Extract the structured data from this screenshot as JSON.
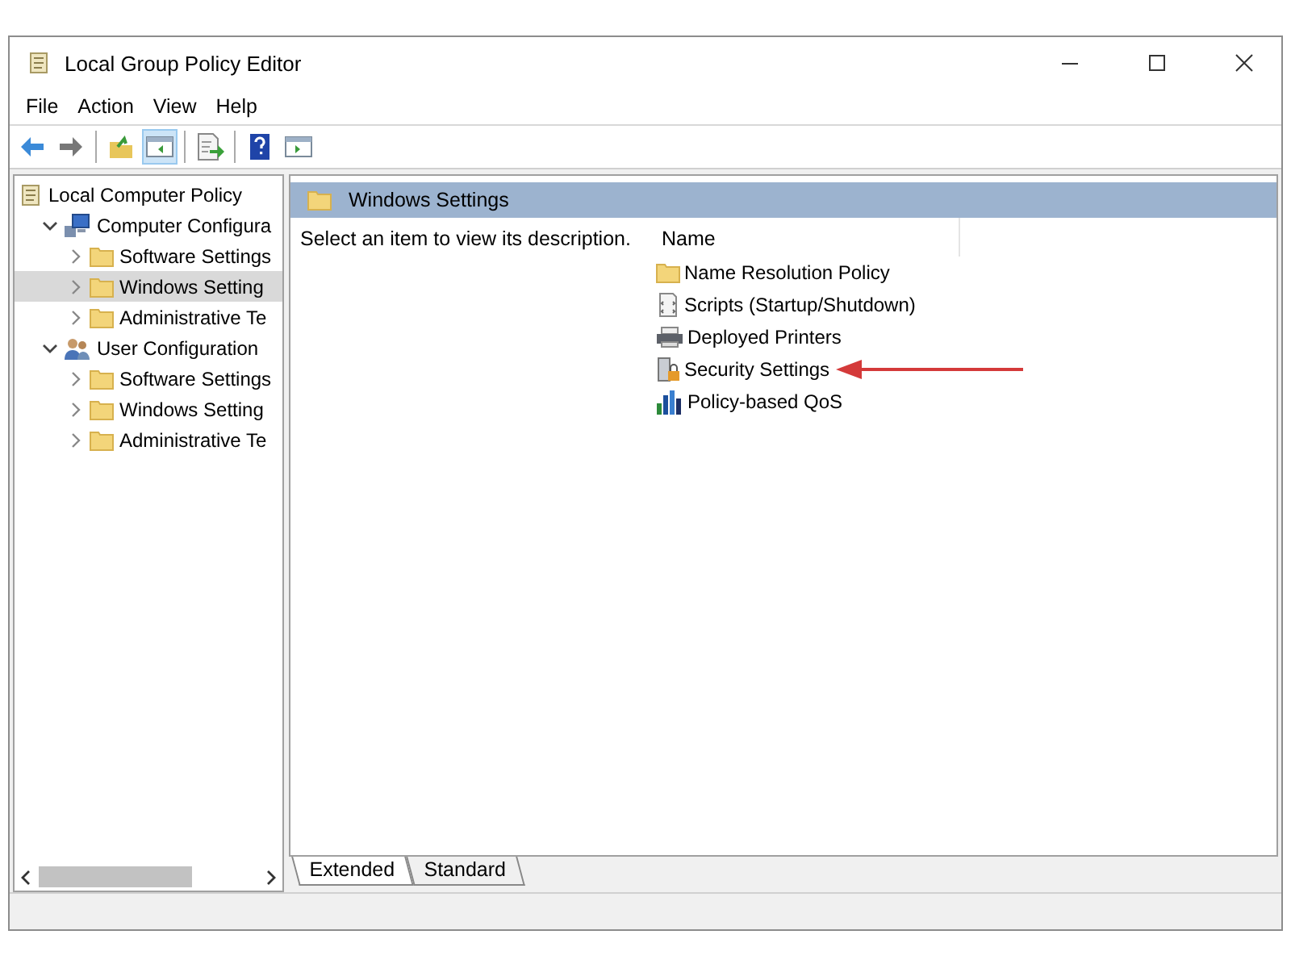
{
  "window": {
    "title": "Local Group Policy Editor"
  },
  "menu": [
    "File",
    "Action",
    "View",
    "Help"
  ],
  "toolbar": [
    [
      {
        "kind": "back",
        "selected": false
      },
      {
        "kind": "forward",
        "selected": false
      }
    ],
    [
      {
        "kind": "up",
        "selected": false
      },
      {
        "kind": "tree",
        "selected": true
      }
    ],
    [
      {
        "kind": "export",
        "selected": false
      }
    ],
    [
      {
        "kind": "help",
        "selected": false
      },
      {
        "kind": "view",
        "selected": false
      }
    ]
  ],
  "tree": [
    {
      "label": "Local Computer Policy",
      "kind": "policy",
      "selected": false,
      "children": [
        {
          "label": "Computer Configura",
          "kind": "computer",
          "selected": false,
          "expanded": true,
          "children": [
            {
              "label": "Software Settings",
              "kind": "folder",
              "selected": false,
              "expanded": false
            },
            {
              "label": "Windows Setting",
              "kind": "folder",
              "selected": true,
              "expanded": false
            },
            {
              "label": "Administrative Te",
              "kind": "folder",
              "selected": false,
              "expanded": false
            }
          ]
        },
        {
          "label": "User Configuration",
          "kind": "user",
          "selected": false,
          "expanded": true,
          "children": [
            {
              "label": "Software Settings",
              "kind": "folder",
              "selected": false,
              "expanded": false
            },
            {
              "label": "Windows Setting",
              "kind": "folder",
              "selected": false,
              "expanded": false
            },
            {
              "label": "Administrative Te",
              "kind": "folder",
              "selected": false,
              "expanded": false
            }
          ]
        }
      ]
    }
  ],
  "content": {
    "header": "Windows Settings",
    "description": "Select an item to view its description.",
    "column": "Name",
    "items": [
      {
        "label": "Name Resolution Policy",
        "kind": "folder"
      },
      {
        "label": "Scripts (Startup/Shutdown)",
        "kind": "script"
      },
      {
        "label": "Deployed Printers",
        "kind": "printer"
      },
      {
        "label": "Security Settings",
        "kind": "security"
      },
      {
        "label": "Policy-based QoS",
        "kind": "qos"
      }
    ]
  },
  "tabs": [
    {
      "label": "Extended",
      "selected": true
    },
    {
      "label": "Standard",
      "selected": false
    }
  ]
}
